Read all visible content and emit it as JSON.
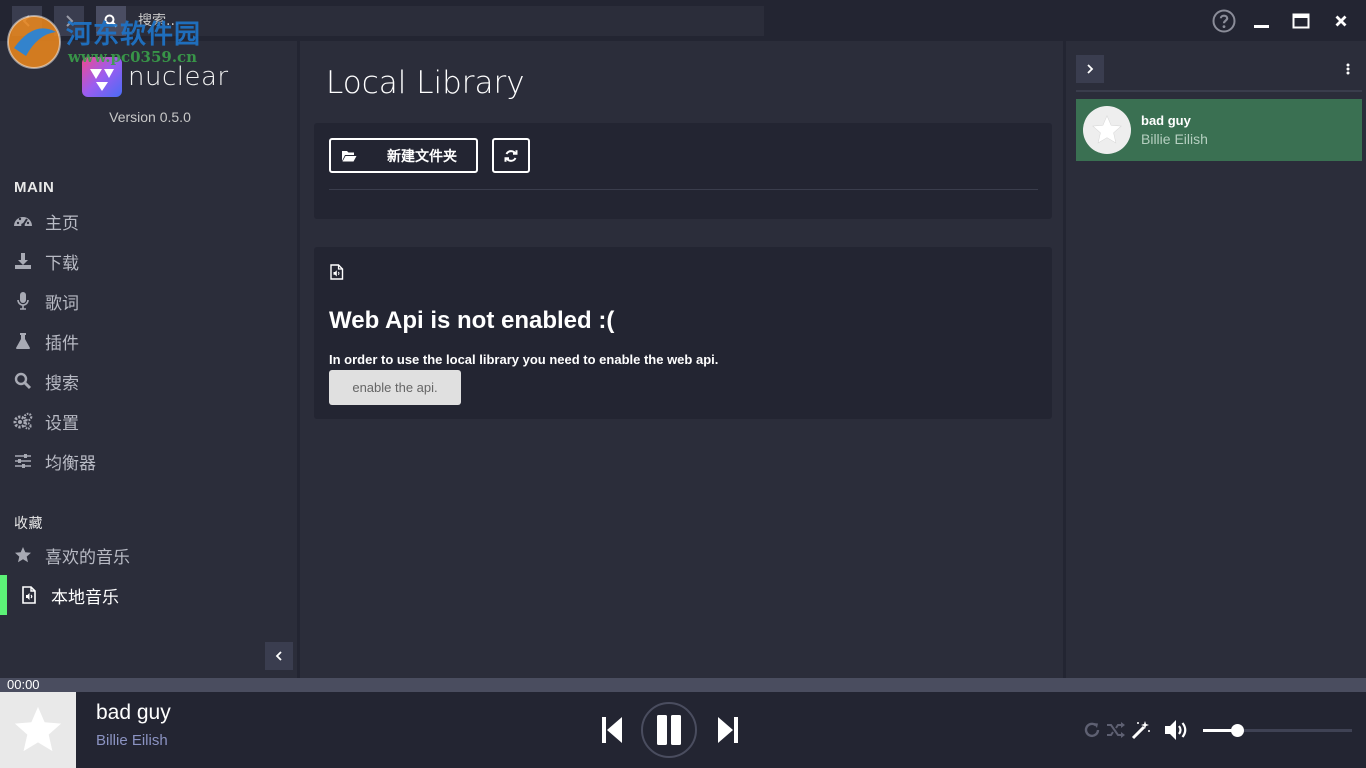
{
  "topbar": {
    "search_placeholder": "搜索..."
  },
  "watermark": {
    "text": "河东软件园",
    "url": "www.pc0359.cn"
  },
  "brand": {
    "name": "nuclear",
    "version": "Version 0.5.0"
  },
  "sidebar": {
    "main_label": "MAIN",
    "main_items": [
      {
        "label": "主页",
        "icon": "dashboard-icon"
      },
      {
        "label": "下载",
        "icon": "download-icon"
      },
      {
        "label": "歌词",
        "icon": "microphone-icon"
      },
      {
        "label": "插件",
        "icon": "flask-icon"
      },
      {
        "label": "搜索",
        "icon": "search-icon"
      },
      {
        "label": "设置",
        "icon": "gears-icon"
      },
      {
        "label": "均衡器",
        "icon": "equalizer-icon"
      }
    ],
    "collection_label": "收藏",
    "collection_items": [
      {
        "label": "喜欢的音乐",
        "icon": "star-icon"
      },
      {
        "label": "本地音乐",
        "icon": "audio-file-icon",
        "active": true
      }
    ]
  },
  "main": {
    "title": "Local Library",
    "add_folder_label": "新建文件夹",
    "error_title": "Web Api is not enabled :(",
    "error_desc": "In order to use the local library you need to enable the web api.",
    "enable_button_label": "enable the api."
  },
  "queue": {
    "items": [
      {
        "title": "bad guy",
        "artist": "Billie Eilish"
      }
    ]
  },
  "player": {
    "time": "00:00",
    "track_title": "bad guy",
    "artist": "Billie Eilish",
    "volume": 0.23
  },
  "colors": {
    "accent_green": "#5cf277",
    "queue_active": "#3a7052",
    "artist_text": "#8b93c2"
  }
}
